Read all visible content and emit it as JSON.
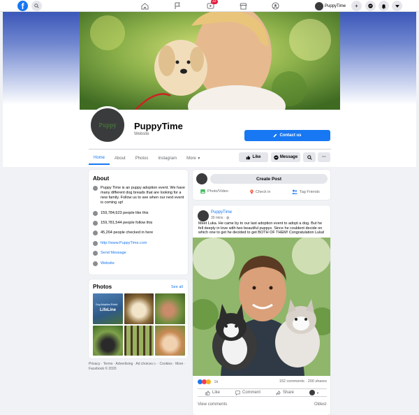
{
  "topbar": {
    "logo": "f",
    "notification_count": "22",
    "user_name": "PuppyTime"
  },
  "page": {
    "name": "PuppyTime",
    "category": "Website",
    "avatar_text": "Puppy",
    "contact_label": "Contact us",
    "tabs": [
      "Home",
      "About",
      "Photos",
      "Instagram",
      "More"
    ],
    "like_label": "Like",
    "message_label": "Message"
  },
  "about": {
    "title": "About",
    "description": "Puppy Time is an puppy adoption event. We have many different dog breads that are looking for a new family. Follow us to see when our next event is coming up!",
    "likes": "159,784,623 people like this",
    "follows": "159,781,544 people follow this",
    "checkins": "45,264 people checked in here",
    "url": "http://www.PuppyTime.com",
    "send_message": "Send Message",
    "website": "Website"
  },
  "photos": {
    "title": "Photos",
    "see_all": "See all",
    "tile1_caption": "Dog Adoption Event",
    "tile1_sub": "LifeLine"
  },
  "footer": "Privacy · Terms · Advertising · Ad choices ▷ · Cookies · More · Facebook © 2020",
  "composer": {
    "create_post": "Create Post",
    "photo_video": "Photo/Video",
    "check_in": "Check in",
    "tag_friends": "Tag Friends"
  },
  "post": {
    "author": "PuppyTime",
    "time": "30 mins",
    "text": "Meet Luka. He came by to our last adoption event to adopt a dog. But he fell deeply in love with two beautiful puppys. Since he couldent decide on which one to get he decided to get BOTH OF THEM! Congratulation Luka!",
    "reaction_count": "1k",
    "stats": "152 comments · 200 shares",
    "like": "Like",
    "comment": "Comment",
    "share": "Share",
    "view_comments": "View comments",
    "oldest": "Oldest"
  },
  "colors": {
    "brand": "#1877f2",
    "background": "#f0f2f5",
    "badge": "#e41e3f"
  },
  "icons": [
    "search-icon",
    "home-icon",
    "flag-icon",
    "video-icon",
    "store-icon",
    "groups-icon",
    "plus-icon",
    "messenger-icon",
    "bell-icon",
    "caret-icon"
  ]
}
